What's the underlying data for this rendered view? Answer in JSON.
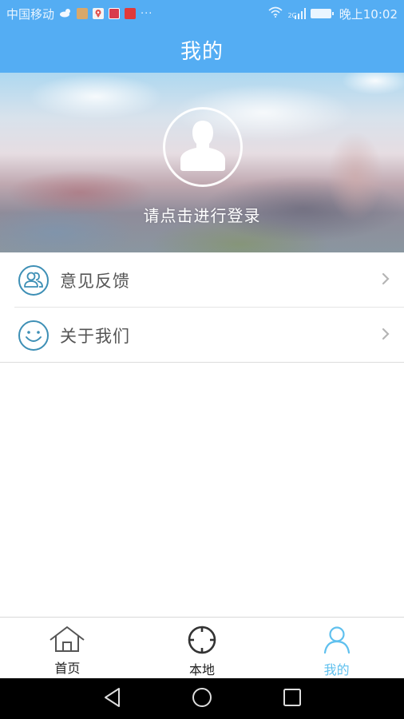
{
  "status_bar": {
    "carrier": "中国移动",
    "network_type": "2G",
    "time": "晚上10:02",
    "more_indicator": "···",
    "notification_icons": [
      "weather-icon",
      "app-icon-orange",
      "map-pin-app-icon",
      "news-app-icon-1",
      "news-app-icon-2"
    ]
  },
  "header": {
    "title": "我的"
  },
  "profile": {
    "avatar_icon": "user-silhouette-icon",
    "login_prompt": "请点击进行登录"
  },
  "menu": {
    "items": [
      {
        "label": "意见反馈",
        "icon": "users-feedback-icon"
      },
      {
        "label": "关于我们",
        "icon": "smiley-icon"
      }
    ]
  },
  "tabs": [
    {
      "label": "首页",
      "icon": "home-icon",
      "active": false
    },
    {
      "label": "本地",
      "icon": "crosshair-icon",
      "active": false
    },
    {
      "label": "我的",
      "icon": "person-icon",
      "active": true
    }
  ],
  "colors": {
    "primary": "#54adf3",
    "active_tab": "#5fc0ee",
    "menu_icon": "#3d8fb5",
    "text_gray": "#555555"
  }
}
